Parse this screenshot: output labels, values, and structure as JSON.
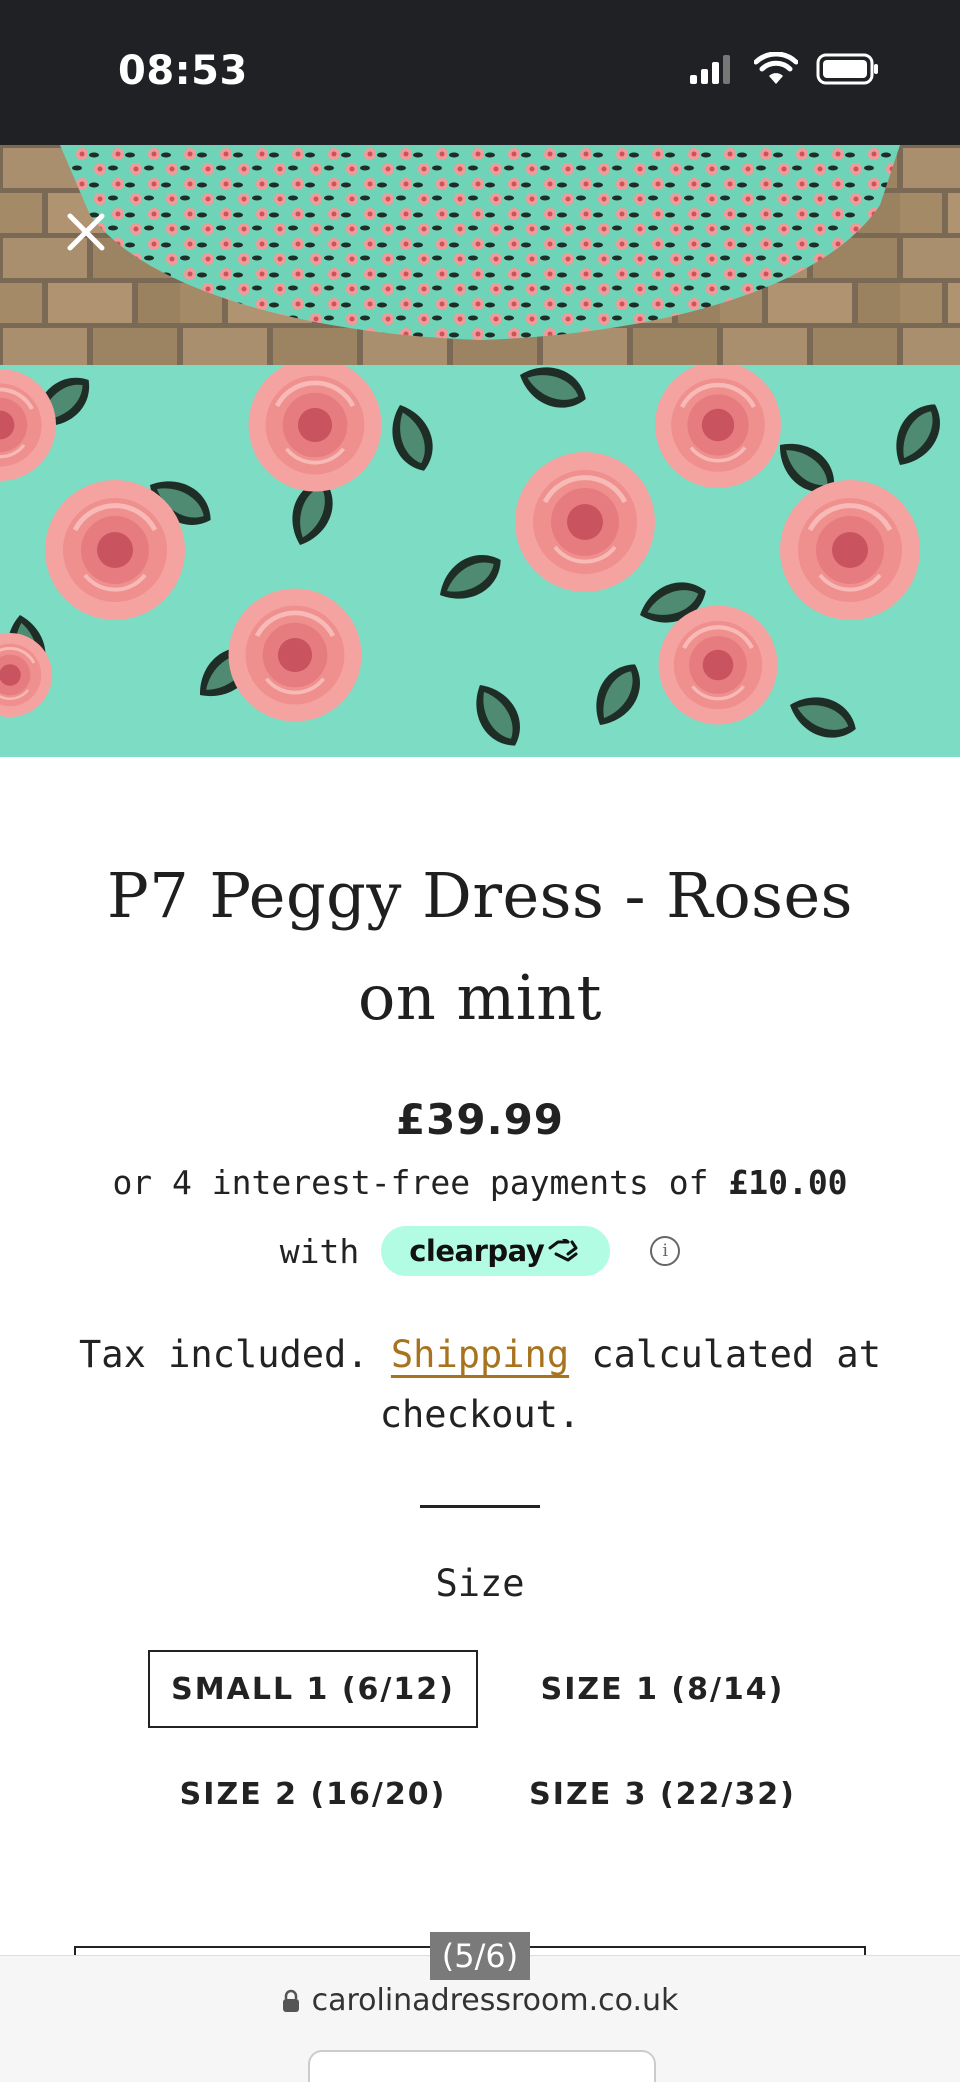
{
  "status_bar": {
    "time": "08:53",
    "icons": [
      "signal-icon",
      "wifi-icon",
      "battery-icon"
    ]
  },
  "product": {
    "title": "P7 Peggy Dress - Roses on mint",
    "price": "£39.99",
    "installments_text": "or 4 interest-free payments of ",
    "installment_amount": "£10.00",
    "with_text": "with",
    "provider": "clearpay",
    "info_symbol": "i",
    "tax_prefix": "Tax included. ",
    "shipping_link": "Shipping",
    "tax_suffix": " calculated at checkout."
  },
  "size": {
    "label": "Size",
    "options": [
      "SMALL 1 (6/12)",
      "SIZE 1 (8/14)",
      "SIZE 2 (16/20)",
      "SIZE 3 (22/32)"
    ],
    "selected": "SMALL 1 (6/12)"
  },
  "viewer": {
    "counter": "(5/6)"
  },
  "browser": {
    "url": "carolinadressroom.co.uk"
  },
  "colors": {
    "mint": "#7ddcc4",
    "rose": "#f4a3a0",
    "clearpay": "#b2fce4",
    "link": "#a8731f"
  }
}
